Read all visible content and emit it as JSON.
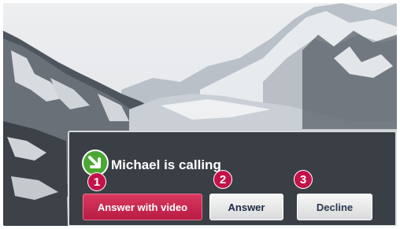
{
  "call": {
    "caller_title": "Michael is calling",
    "icon": "incoming-call-arrow-icon"
  },
  "badges": [
    "1",
    "2",
    "3"
  ],
  "buttons": {
    "answer_video": "Answer with video",
    "answer": "Answer",
    "decline": "Decline"
  },
  "colors": {
    "accent_red": "#c3124a",
    "video_button": "#c8294f",
    "dialog_bg": "#3a3f45",
    "call_icon_green": "#4aa832"
  }
}
